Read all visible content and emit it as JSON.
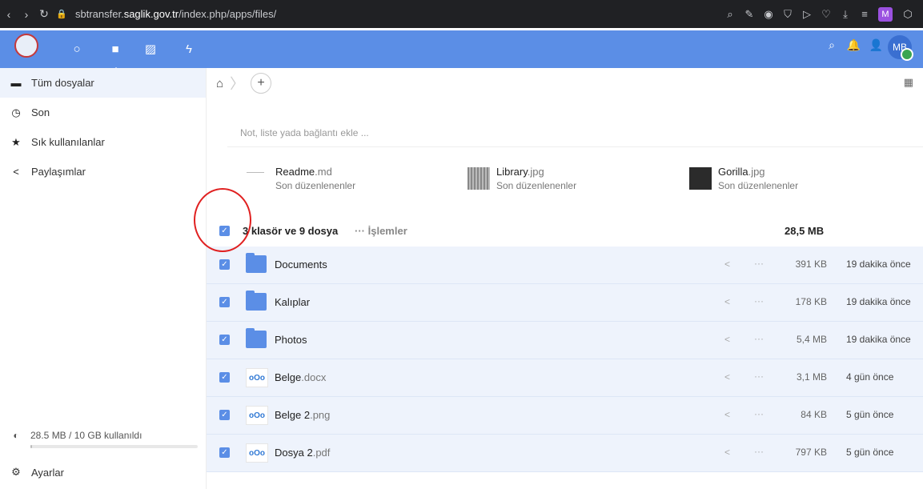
{
  "browser": {
    "url_prefix": "sbtransfer.",
    "url_domain": "saglik.gov.tr",
    "url_path": "/index.php/apps/files/",
    "profile_letter": "M"
  },
  "header": {
    "avatar_initials": "MB"
  },
  "sidebar": {
    "items": [
      {
        "label": "Tüm dosyalar",
        "icon": "folder-icon"
      },
      {
        "label": "Son",
        "icon": "clock-icon"
      },
      {
        "label": "Sık kullanılanlar",
        "icon": "star-icon"
      },
      {
        "label": "Paylaşımlar",
        "icon": "share-icon"
      }
    ],
    "quota_text": "28.5 MB / 10 GB kullanıldı",
    "quota_fraction": 0.003,
    "settings_label": "Ayarlar"
  },
  "main": {
    "note_placeholder": "Not, liste yada bağlantı ekle ...",
    "recent": [
      {
        "name": "Readme",
        "ext": ".md",
        "sub": "Son düzenlenenler"
      },
      {
        "name": "Library",
        "ext": ".jpg",
        "sub": "Son düzenlenenler"
      },
      {
        "name": "Gorilla",
        "ext": ".jpg",
        "sub": "Son düzenlenenler"
      }
    ],
    "summary": {
      "count": "3 klasör ve 9 dosya",
      "actions": "İşlemler",
      "total_size": "28,5 MB"
    },
    "files": [
      {
        "name": "Documents",
        "ext": "",
        "type": "folder",
        "size": "391 KB",
        "date": "19 dakika önce"
      },
      {
        "name": "Kalıplar",
        "ext": "",
        "type": "folder",
        "size": "178 KB",
        "date": "19 dakika önce"
      },
      {
        "name": "Photos",
        "ext": "",
        "type": "folder",
        "size": "5,4 MB",
        "date": "19 dakika önce"
      },
      {
        "name": "Belge",
        "ext": ".docx",
        "type": "file",
        "size": "3,1 MB",
        "date": "4 gün önce"
      },
      {
        "name": "Belge 2",
        "ext": ".png",
        "type": "file",
        "size": "84 KB",
        "date": "5 gün önce"
      },
      {
        "name": "Dosya 2",
        "ext": ".pdf",
        "type": "file",
        "size": "797 KB",
        "date": "5 gün önce"
      }
    ]
  }
}
